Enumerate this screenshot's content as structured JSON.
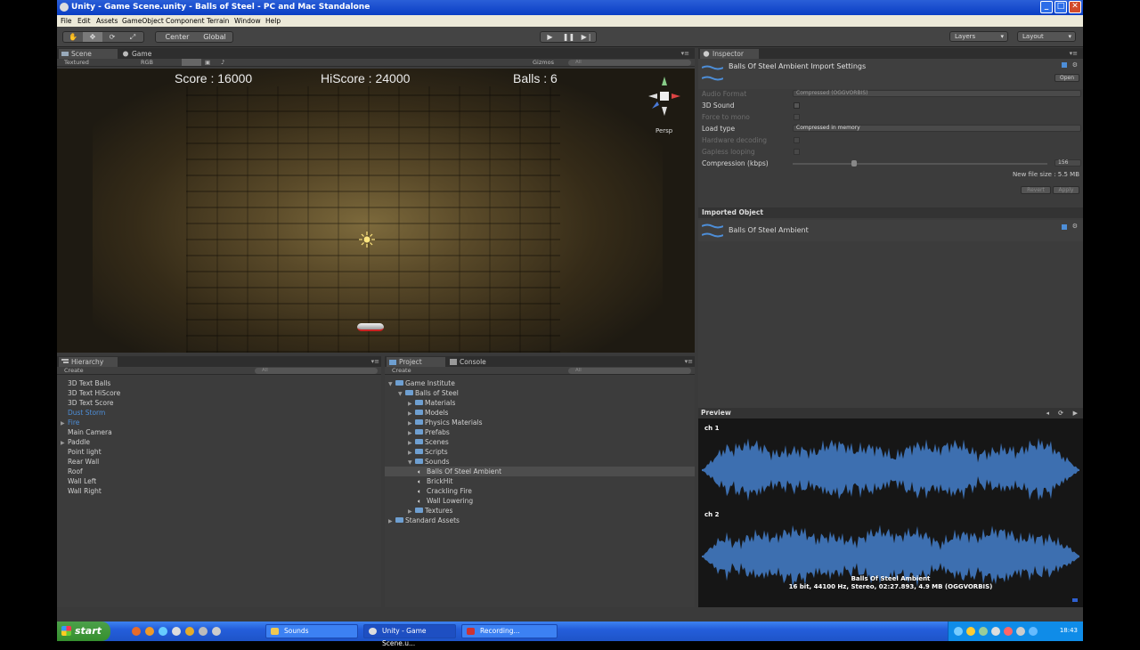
{
  "window": {
    "title": "Unity - Game Scene.unity - Balls of Steel - PC and Mac Standalone"
  },
  "menu": [
    "File",
    "Edit",
    "Assets",
    "GameObject",
    "Component",
    "Terrain",
    "Window",
    "Help"
  ],
  "toolbar": {
    "pivot": "Center",
    "space": "Global",
    "layers": "Layers",
    "layout": "Layout"
  },
  "scene_panel": {
    "tabs": [
      "Scene",
      "Game"
    ],
    "render_mode": "Textured",
    "color_mode": "RGB",
    "gizmos": "Gizmos",
    "search": "All",
    "hud": {
      "score": "Score : 16000",
      "hiscore": "HiScore : 24000",
      "balls": "Balls : 6"
    },
    "view_label": "Persp"
  },
  "inspector": {
    "tab": "Inspector",
    "title": "Balls Of Steel Ambient Import Settings",
    "open_button": "Open",
    "rows": [
      {
        "label": "Audio Format",
        "value": "Compressed (OGGVORBIS)",
        "enabled": false,
        "type": "dropdown"
      },
      {
        "label": "3D Sound",
        "enabled": true,
        "type": "check"
      },
      {
        "label": "Force to mono",
        "enabled": false,
        "type": "check"
      },
      {
        "label": "Load type",
        "value": "Compressed in memory",
        "enabled": true,
        "type": "dropdown"
      },
      {
        "label": "Hardware decoding",
        "enabled": false,
        "type": "check"
      },
      {
        "label": "Gapless looping",
        "enabled": false,
        "type": "check"
      },
      {
        "label": "Compression (kbps)",
        "enabled": true,
        "type": "slider",
        "value": "156"
      }
    ],
    "new_file_size": "New file size : 5.5 MB",
    "revert": "Revert",
    "apply": "Apply",
    "imported_header": "Imported Object",
    "imported_name": "Balls Of Steel Ambient"
  },
  "hierarchy": {
    "tab": "Hierarchy",
    "create": "Create",
    "search": "All",
    "items": [
      {
        "label": "3D Text Balls",
        "blue": false,
        "arrow": false
      },
      {
        "label": "3D Text HiScore",
        "blue": false,
        "arrow": false
      },
      {
        "label": "3D Text Score",
        "blue": false,
        "arrow": false
      },
      {
        "label": "Dust Storm",
        "blue": true,
        "arrow": false
      },
      {
        "label": "Fire",
        "blue": true,
        "arrow": true
      },
      {
        "label": "Main Camera",
        "blue": false,
        "arrow": false
      },
      {
        "label": "Paddle",
        "blue": false,
        "arrow": true
      },
      {
        "label": "Point light",
        "blue": false,
        "arrow": false
      },
      {
        "label": "Rear Wall",
        "blue": false,
        "arrow": false
      },
      {
        "label": "Roof",
        "blue": false,
        "arrow": false
      },
      {
        "label": "Wall Left",
        "blue": false,
        "arrow": false
      },
      {
        "label": "Wall Right",
        "blue": false,
        "arrow": false
      }
    ]
  },
  "project": {
    "tabs": [
      "Project",
      "Console"
    ],
    "create": "Create",
    "search": "All",
    "items": [
      {
        "label": "Game Institute",
        "depth": 0,
        "kind": "folder",
        "open": true
      },
      {
        "label": "Balls of Steel",
        "depth": 1,
        "kind": "folder",
        "open": true
      },
      {
        "label": "Materials",
        "depth": 2,
        "kind": "folder",
        "open": false
      },
      {
        "label": "Models",
        "depth": 2,
        "kind": "folder",
        "open": false
      },
      {
        "label": "Physics Materials",
        "depth": 2,
        "kind": "folder",
        "open": false
      },
      {
        "label": "Prefabs",
        "depth": 2,
        "kind": "folder",
        "open": false
      },
      {
        "label": "Scenes",
        "depth": 2,
        "kind": "folder",
        "open": false
      },
      {
        "label": "Scripts",
        "depth": 2,
        "kind": "folder",
        "open": null
      },
      {
        "label": "Sounds",
        "depth": 2,
        "kind": "folder",
        "open": true
      },
      {
        "label": "Balls Of Steel Ambient",
        "depth": 3,
        "kind": "sound",
        "selected": true
      },
      {
        "label": "BrickHit",
        "depth": 3,
        "kind": "sound"
      },
      {
        "label": "Crackling Fire",
        "depth": 3,
        "kind": "sound"
      },
      {
        "label": "Wall Lowering",
        "depth": 3,
        "kind": "sound"
      },
      {
        "label": "Textures",
        "depth": 2,
        "kind": "folder",
        "open": false
      },
      {
        "label": "Standard Assets",
        "depth": 0,
        "kind": "folder",
        "open": false
      }
    ]
  },
  "preview": {
    "header": "Preview",
    "channels": [
      "ch 1",
      "ch 2"
    ],
    "clip_name": "Balls Of Steel Ambient",
    "clip_info": "16 bit, 44100 Hz, Stereo, 02:27.893, 4.9 MB (OGGVORBIS)"
  },
  "taskbar": {
    "start": "start",
    "tasks": [
      "Sounds",
      "Unity - Game Scene.u...",
      "Recording..."
    ],
    "clock": "18:43"
  },
  "colors": {
    "accent_blue": "#4d8ed8",
    "wave_blue": "#3d6fb0",
    "panel": "#3c3c3c"
  }
}
